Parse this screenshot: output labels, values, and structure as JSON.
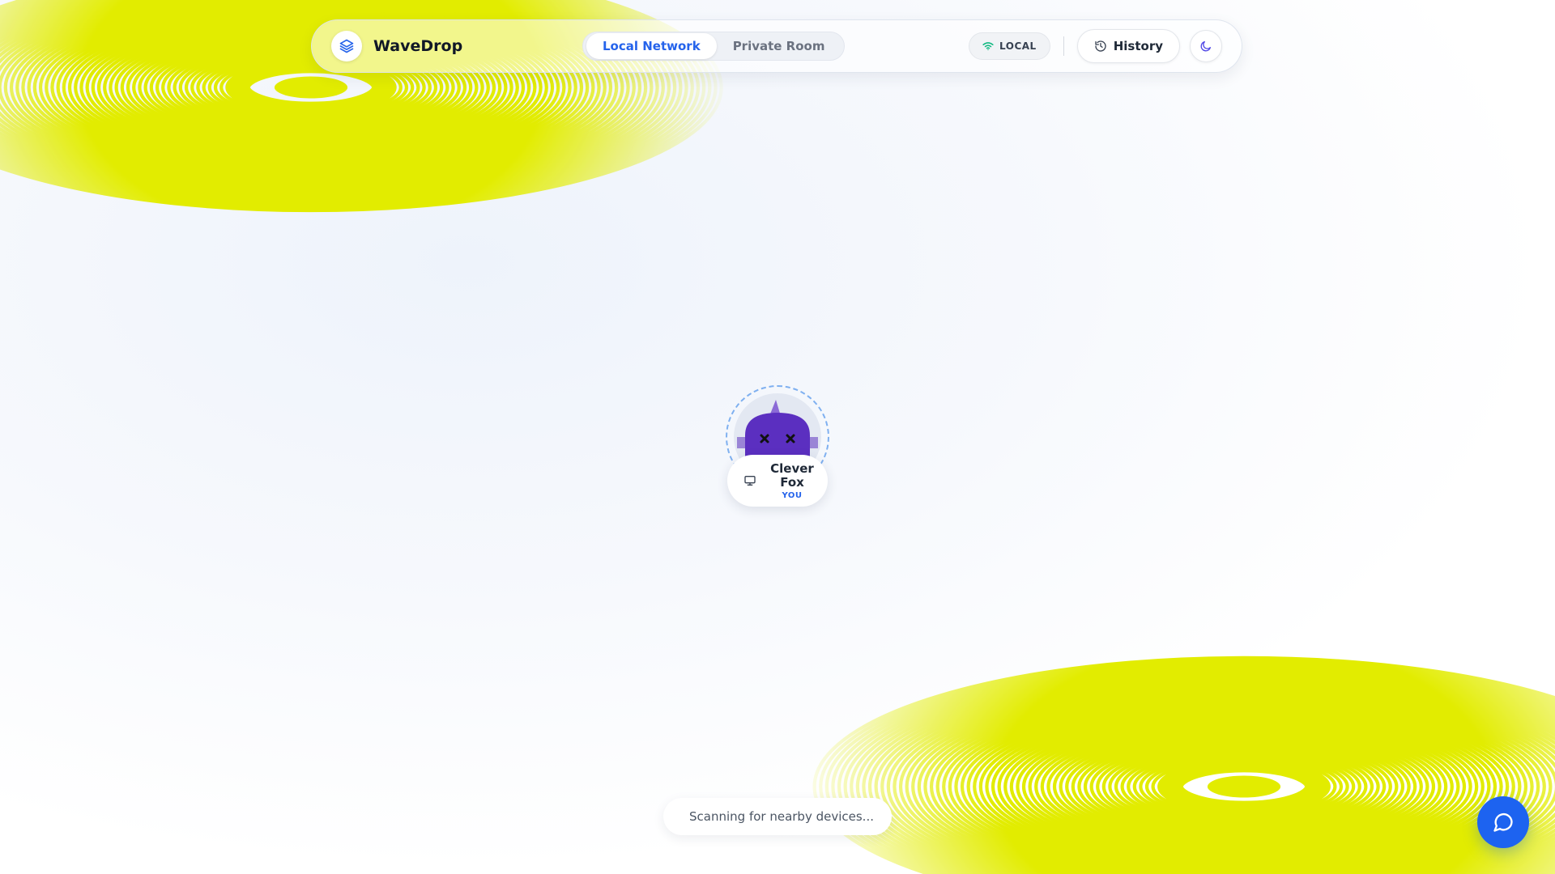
{
  "app": {
    "name": "WaveDrop",
    "logo_icon": "layers-icon"
  },
  "tabs": [
    {
      "label": "Local Network",
      "active": true
    },
    {
      "label": "Private Room",
      "active": false
    }
  ],
  "status_badge": {
    "label": "LOCAL",
    "icon": "wifi-icon",
    "color": "#10b981"
  },
  "toolbar": {
    "history_label": "History",
    "history_icon": "history-icon",
    "theme_icon": "moon-icon"
  },
  "device": {
    "name": "Clever Fox",
    "you_label": "YOU",
    "type_icon": "monitor-icon",
    "avatar_icon": "robot-avatar-icon"
  },
  "status_text": "Scanning for nearby devices...",
  "chat": {
    "icon": "chat-bubble-icon"
  },
  "colors": {
    "accent": "#2563eb",
    "fab": "#1d63f0",
    "ring_yellow": "#e2ec00",
    "avatar_purple": "#5b2fc0"
  }
}
